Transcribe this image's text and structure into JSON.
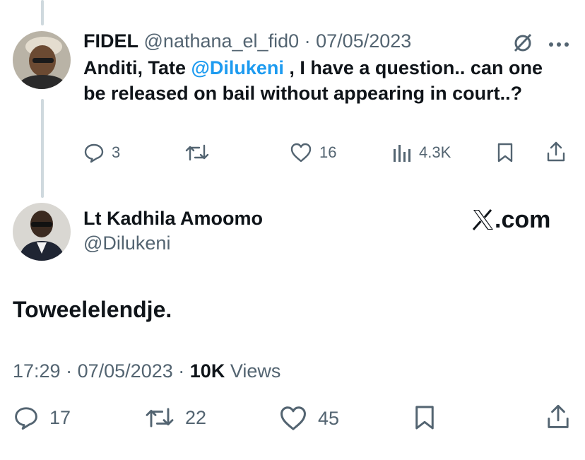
{
  "reply": {
    "author_name": "FIDEL",
    "author_handle": "@nathana_el_fid0",
    "separator": "·",
    "date": "07/05/2023",
    "text_part1": "Anditi, Tate ",
    "mention": "@Dilukeni",
    "text_part2": " , I have a question.. can one be released on bail without appearing in court..?",
    "replies_count": "3",
    "likes_count": "16",
    "views_count": "4.3K"
  },
  "main": {
    "author_name": "Lt Kadhila Amoomo",
    "author_handle": "@Dilukeni",
    "brand_label": ".com",
    "text": "Toweelelendje.",
    "time": "17:29",
    "separator1": "·",
    "date": "07/05/2023",
    "separator2": "·",
    "views_count": "10K",
    "views_label": "Views",
    "replies_count": "17",
    "retweets_count": "22",
    "likes_count": "45"
  },
  "icons": [
    "grok-icon",
    "more-icon",
    "reply-icon",
    "retweet-icon",
    "like-icon",
    "views-icon",
    "bookmark-icon",
    "share-icon",
    "x-logo-icon"
  ],
  "colors": {
    "text": "#0f1419",
    "muted": "#536471",
    "link": "#1d9bf0",
    "thread_line": "#cfd9de"
  }
}
